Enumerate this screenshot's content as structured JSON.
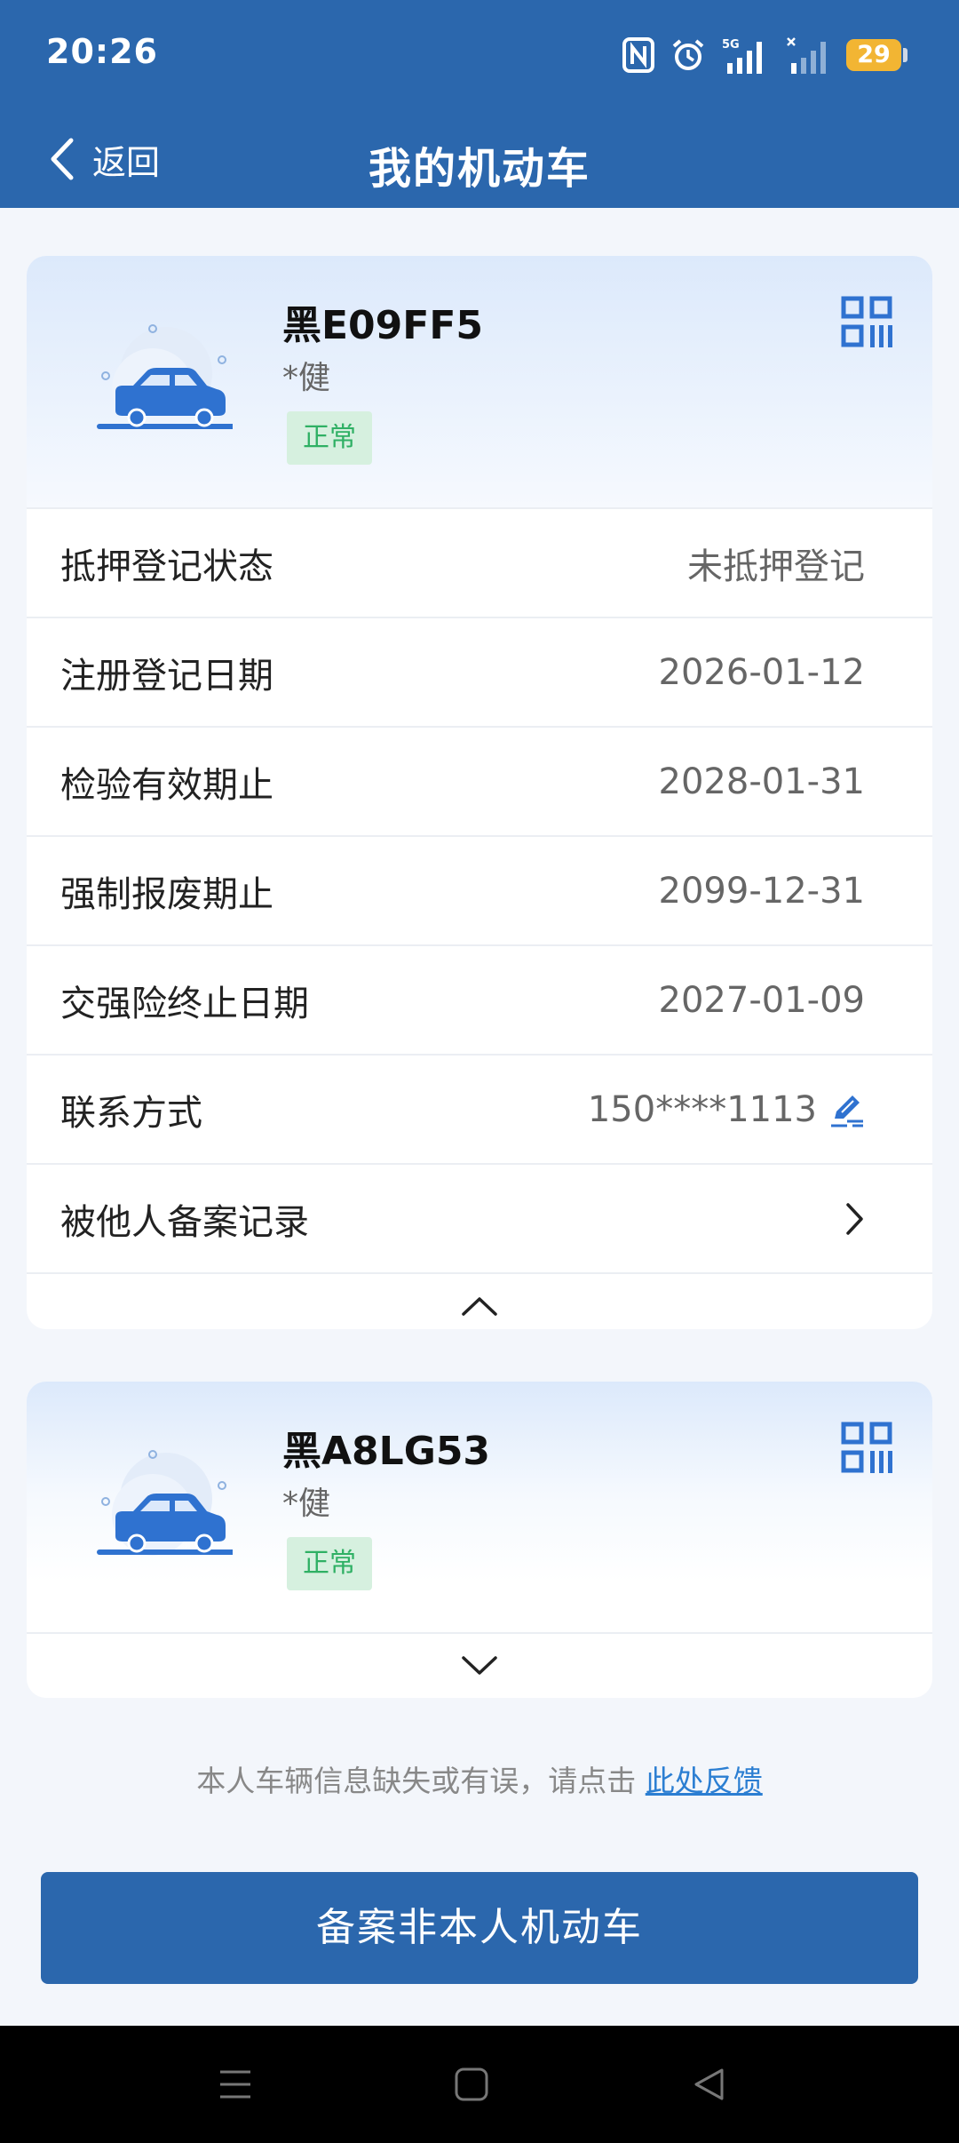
{
  "status_bar": {
    "time": "20:26",
    "battery": "29",
    "network": "5G"
  },
  "nav": {
    "back_label": "返回",
    "title": "我的机动车"
  },
  "vehicles": [
    {
      "plate": "黑E09FF5",
      "owner": "*健",
      "status": "正常",
      "expanded": true,
      "details": [
        {
          "label": "抵押登记状态",
          "value": "未抵押登记"
        },
        {
          "label": "注册登记日期",
          "value": "2026-01-12"
        },
        {
          "label": "检验有效期止",
          "value": "2028-01-31"
        },
        {
          "label": "强制报废期止",
          "value": "2099-12-31"
        },
        {
          "label": "交强险终止日期",
          "value": "2027-01-09"
        },
        {
          "label": "联系方式",
          "value": "150****1113"
        },
        {
          "label": "被他人备案记录",
          "value": ""
        }
      ]
    },
    {
      "plate": "黑A8LG53",
      "owner": "*健",
      "status": "正常",
      "expanded": false
    }
  ],
  "feedback": {
    "text": "本人车辆信息缺失或有误，请点击",
    "link": "此处反馈"
  },
  "primary_button": "备案非本人机动车",
  "colors": {
    "brand": "#2b67ad",
    "status_green": "#2fb064",
    "link": "#2b7ed2"
  }
}
